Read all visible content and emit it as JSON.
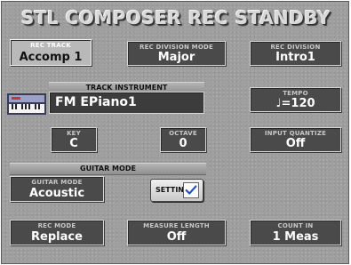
{
  "title": "STL COMPOSER REC STANDBY",
  "fields": {
    "rec_track": {
      "label": "REC TRACK",
      "value": "Accomp 1"
    },
    "rec_div_mode": {
      "label": "REC DIVISION MODE",
      "value": "Major"
    },
    "rec_division": {
      "label": "REC DIVISION",
      "value": "Intro1"
    },
    "tempo": {
      "label": "TEMPO",
      "value": "♩=120"
    },
    "key": {
      "label": "KEY",
      "value": "C"
    },
    "octave": {
      "label": "OCTAVE",
      "value": "0"
    },
    "input_quantize": {
      "label": "INPUT QUANTIZE",
      "value": "Off"
    },
    "guitar_mode": {
      "label": "GUITAR MODE",
      "value": "Acoustic"
    },
    "rec_mode": {
      "label": "REC MODE",
      "value": "Replace"
    },
    "measure_length": {
      "label": "MEASURE LENGTH",
      "value": "Off"
    },
    "count_in": {
      "label": "COUNT IN",
      "value": "1 Meas"
    }
  },
  "track_instrument": {
    "header": "TRACK INSTRUMENT",
    "name": "FM EPiano1",
    "icon": "keyboard-icon"
  },
  "guitar_section": {
    "header": "GUITAR MODE"
  },
  "setting_button": {
    "label": "SETTING",
    "icon": "checkmark-icon"
  },
  "colors": {
    "panel": "#9e9e9e",
    "box": "#4a4a4a",
    "selected": "#b9b9b9"
  }
}
